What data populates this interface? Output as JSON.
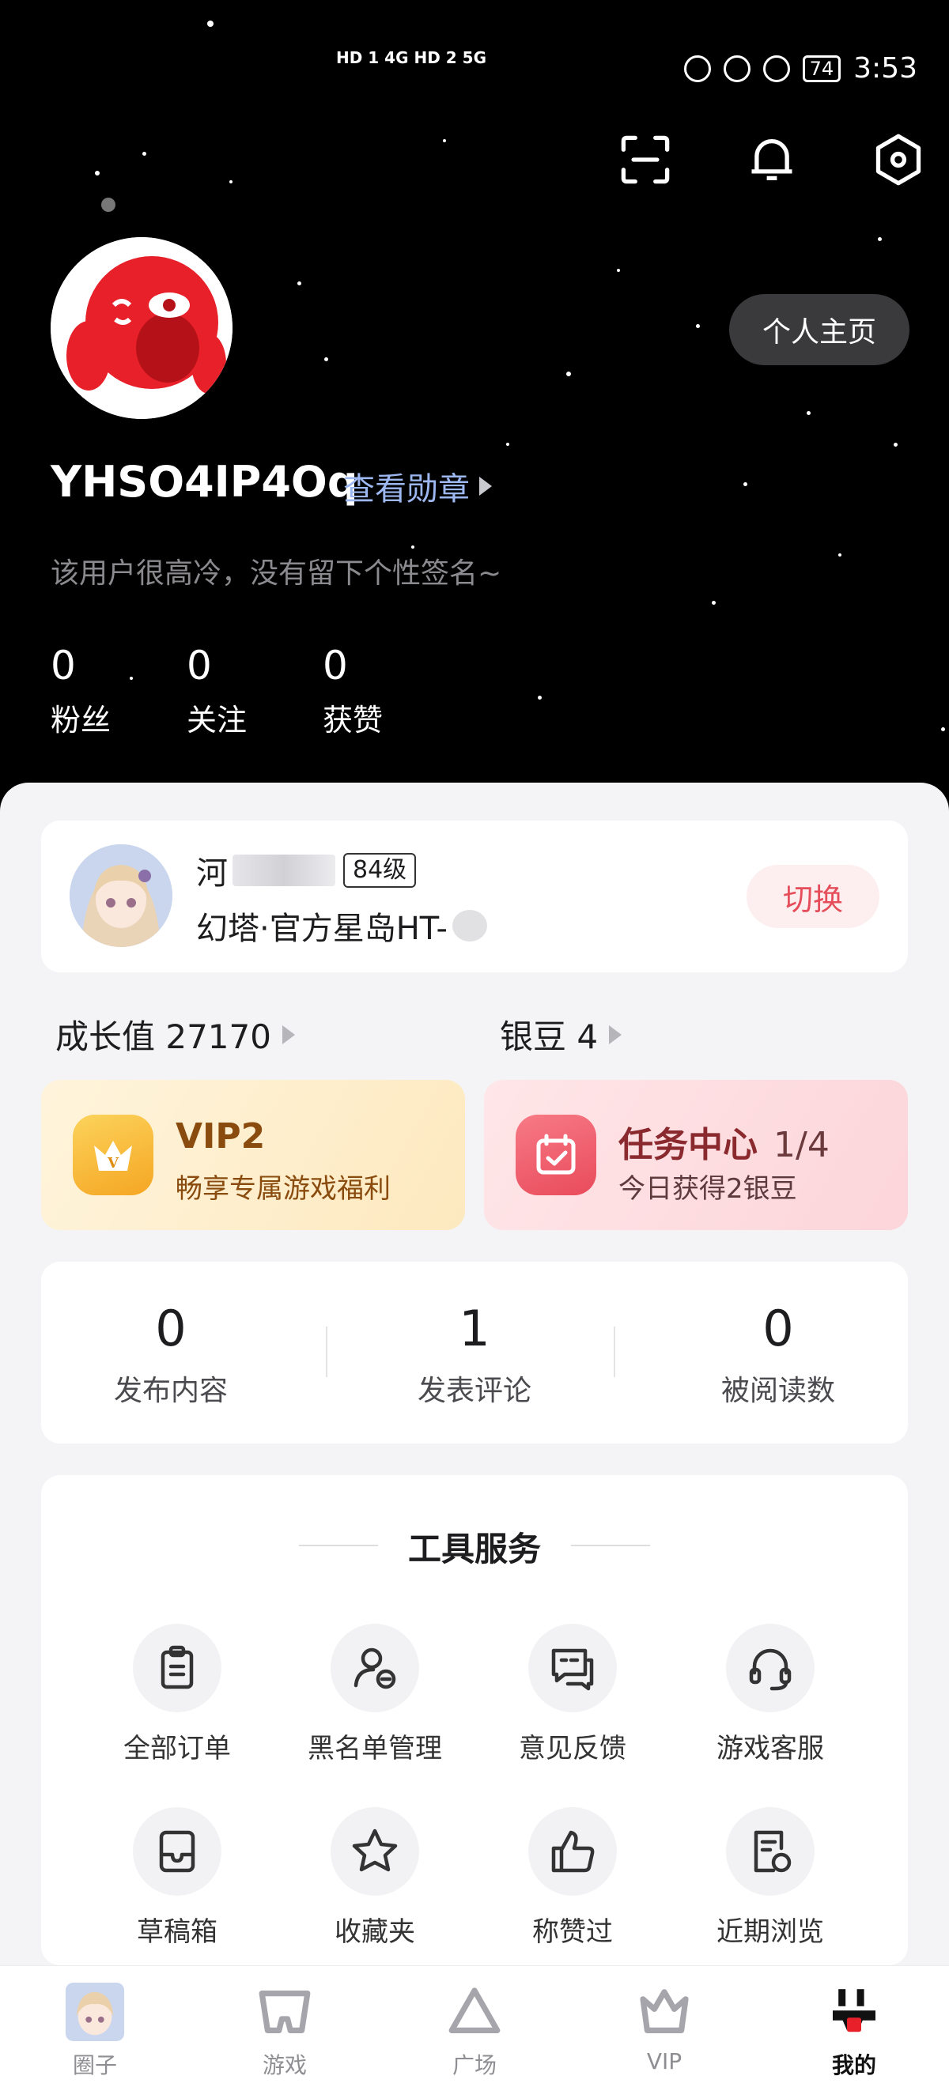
{
  "status_bar": {
    "signal_text": "HD 1 4G  HD 2 5G",
    "battery": "74",
    "time": "3:53"
  },
  "header": {
    "homepage_button": "个人主页",
    "username": "YHSO4IP4Oq",
    "view_medals": "查看勋章",
    "bio": "该用户很高冷，没有留下个性签名~",
    "stats": [
      {
        "value": "0",
        "label": "粉丝"
      },
      {
        "value": "0",
        "label": "关注"
      },
      {
        "value": "0",
        "label": "获赞"
      }
    ]
  },
  "game_card": {
    "name_prefix": "河",
    "level": "84级",
    "server": "幻塔·官方星岛HT-",
    "switch_label": "切换"
  },
  "growth": {
    "growth_label": "成长值 27170",
    "beans_label": "银豆 4"
  },
  "promos": {
    "vip_title": "VIP2",
    "vip_sub": "畅享专属游戏福利",
    "task_title": "任务中心",
    "task_count": "1/4",
    "task_sub": "今日获得2银豆"
  },
  "content_counts": [
    {
      "value": "0",
      "label": "发布内容"
    },
    {
      "value": "1",
      "label": "发表评论"
    },
    {
      "value": "0",
      "label": "被阅读数"
    }
  ],
  "tools": {
    "title": "工具服务",
    "items": [
      {
        "label": "全部订单",
        "icon": "clipboard-icon"
      },
      {
        "label": "黑名单管理",
        "icon": "user-block-icon"
      },
      {
        "label": "意见反馈",
        "icon": "feedback-icon"
      },
      {
        "label": "游戏客服",
        "icon": "headset-icon"
      },
      {
        "label": "草稿箱",
        "icon": "drafts-icon"
      },
      {
        "label": "收藏夹",
        "icon": "star-icon"
      },
      {
        "label": "称赞过",
        "icon": "thumbs-up-icon"
      },
      {
        "label": "近期浏览",
        "icon": "history-icon"
      }
    ]
  },
  "bottom_nav": [
    {
      "label": "圈子"
    },
    {
      "label": "游戏"
    },
    {
      "label": "广场"
    },
    {
      "label": "VIP"
    },
    {
      "label": "我的"
    }
  ],
  "colors": {
    "accent_red": "#e54d5a",
    "vip_brown": "#8a4b0e",
    "header_bg": "#000000"
  }
}
